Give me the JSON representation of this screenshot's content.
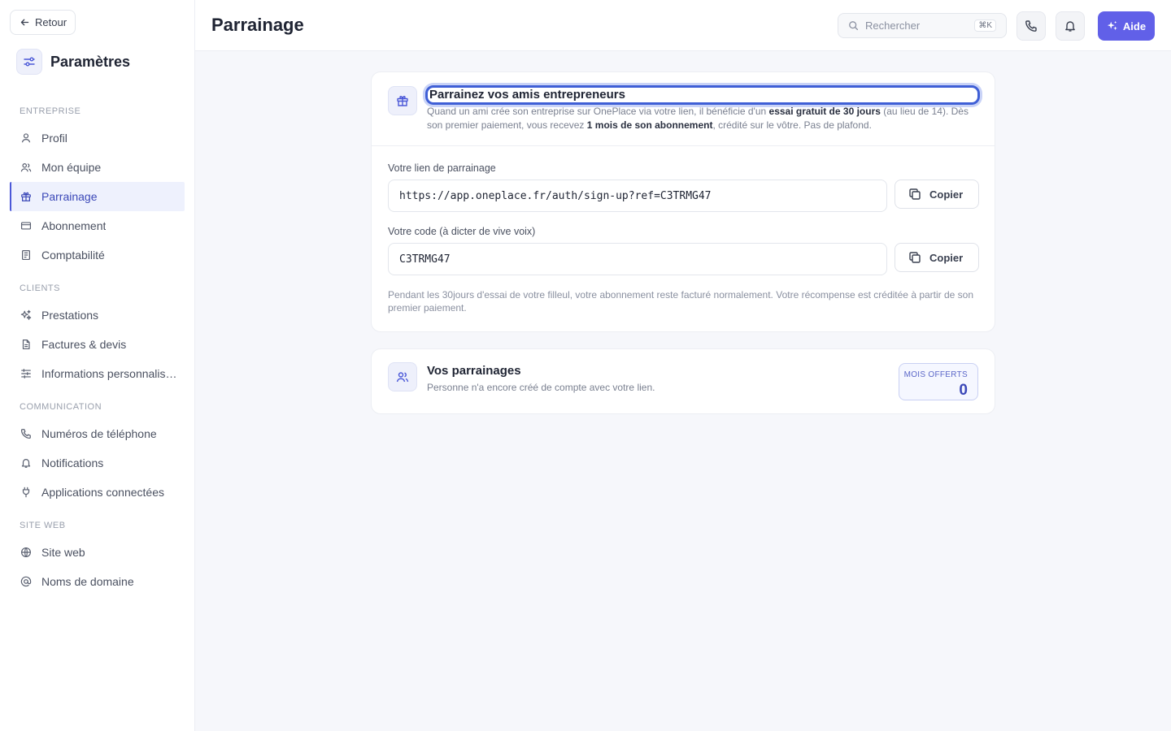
{
  "sidebar": {
    "back_label": "Retour",
    "title": "Paramètres",
    "sections": [
      {
        "title": "ENTREPRISE",
        "items": [
          {
            "label": "Profil",
            "icon": "user-icon"
          },
          {
            "label": "Mon équipe",
            "icon": "users-icon"
          },
          {
            "label": "Parrainage",
            "icon": "gift-icon",
            "active": true
          },
          {
            "label": "Abonnement",
            "icon": "credit-card-icon"
          },
          {
            "label": "Comptabilité",
            "icon": "ledger-icon"
          }
        ]
      },
      {
        "title": "CLIENTS",
        "items": [
          {
            "label": "Prestations",
            "icon": "sparkles-icon"
          },
          {
            "label": "Factures & devis",
            "icon": "file-icon"
          },
          {
            "label": "Informations personnalis…",
            "icon": "sliders-icon"
          }
        ]
      },
      {
        "title": "COMMUNICATION",
        "items": [
          {
            "label": "Numéros de téléphone",
            "icon": "phone-icon"
          },
          {
            "label": "Notifications",
            "icon": "bell-icon"
          },
          {
            "label": "Applications connectées",
            "icon": "plug-icon"
          }
        ]
      },
      {
        "title": "SITE WEB",
        "items": [
          {
            "label": "Site web",
            "icon": "globe-icon"
          },
          {
            "label": "Noms de domaine",
            "icon": "at-icon"
          }
        ]
      }
    ]
  },
  "header": {
    "title": "Parrainage",
    "search_placeholder": "Rechercher",
    "search_shortcut": "⌘K",
    "help_label": "Aide"
  },
  "referral": {
    "title": "Parrainez vos amis entrepreneurs",
    "desc_1": "Quand un ami crée son entreprise sur OnePlace via votre lien, il bénéficie d'un ",
    "desc_bold_1": "essai gratuit de 30 jours",
    "desc_2": " (au lieu de 14). Dès son premier paiement, vous recevez ",
    "desc_bold_2": "1 mois de son abonnement",
    "desc_3": ", crédité sur le vôtre. Pas de plafond.",
    "link_label": "Votre lien de parrainage",
    "link_value": "https://app.oneplace.fr/auth/sign-up?ref=C3TRMG47",
    "code_label": "Votre code (à dicter de vive voix)",
    "code_value": "C3TRMG47",
    "copy_label": "Copier",
    "note": "Pendant les 30jours d'essai de votre filleul, votre abonnement reste facturé normalement. Votre récompense est créditée à partir de son premier paiement."
  },
  "referrals": {
    "title": "Vos parrainages",
    "subtitle": "Personne n'a encore créé de compte avec votre lien.",
    "counter_label": "MOIS OFFERTS",
    "counter_value": "0"
  },
  "colors": {
    "accent": "#6160e8",
    "active_nav": "#3b48b8",
    "focus_ring": "#3f5fd6"
  }
}
